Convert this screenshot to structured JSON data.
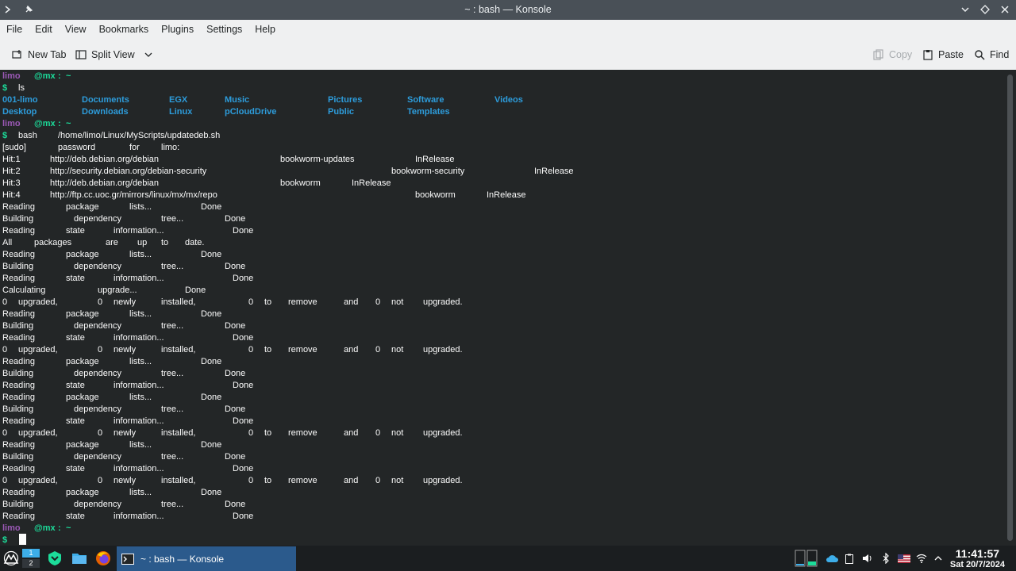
{
  "window": {
    "title": "~ : bash — Konsole"
  },
  "menubar": [
    "File",
    "Edit",
    "View",
    "Bookmarks",
    "Plugins",
    "Settings",
    "Help"
  ],
  "toolbar": {
    "new_tab": "New Tab",
    "split_view": "Split View",
    "copy": "Copy",
    "paste": "Paste",
    "find": "Find"
  },
  "terminal": {
    "prompt_user": "limo",
    "prompt_host": "@mx",
    "prompt_sep": ":",
    "prompt_path": "~",
    "prompt_symbol": "$",
    "cmd1": "ls",
    "ls_row1": [
      "001-limo",
      "Documents",
      "EGX",
      "Music",
      "Pictures",
      "Software",
      "Videos"
    ],
    "ls_row2": [
      "Desktop",
      "Downloads",
      "Linux",
      "pCloudDrive",
      "Public",
      "Templates"
    ],
    "cmd2_a": "bash",
    "cmd2_b": "/home/limo/Linux/MyScripts/updatedeb.sh",
    "sudo_line": [
      "[sudo]",
      "password",
      "for",
      "limo:"
    ],
    "hit1": [
      "Hit:1",
      "http://deb.debian.org/debian",
      "bookworm-updates",
      "InRelease"
    ],
    "hit2": [
      "Hit:2",
      "http://security.debian.org/debian-security",
      "bookworm-security",
      "InRelease"
    ],
    "hit3": [
      "Hit:3",
      "http://deb.debian.org/debian",
      "bookworm",
      "InRelease"
    ],
    "hit4": [
      "Hit:4",
      "http://ftp.cc.uoc.gr/mirrors/linux/mx/mx/repo",
      "bookworm",
      "InRelease"
    ],
    "reading_pkg": [
      "Reading",
      "package",
      "lists...",
      "Done"
    ],
    "building_dep": [
      "Building",
      "dependency",
      "tree...",
      "Done"
    ],
    "reading_state": [
      "Reading",
      "state",
      "information...",
      "Done"
    ],
    "all_uptodate": [
      "All",
      "packages",
      "are",
      "up",
      "to",
      "date."
    ],
    "calculating": [
      "Calculating",
      "upgrade...",
      "Done"
    ],
    "upgraded": [
      "0",
      "upgraded,",
      "0",
      "newly",
      "installed,",
      "0",
      "to",
      "remove",
      "and",
      "0",
      "not",
      "upgraded."
    ]
  },
  "taskbar": {
    "pager": [
      "1",
      "2"
    ],
    "task_label": "~ : bash — Konsole",
    "time": "11:41:57",
    "date": "Sat 20/7/2024"
  },
  "colors": {
    "terminal_bg": "#232627",
    "user": "#9b59b6",
    "host": "#1cdc9a",
    "dir": "#2d9cdb",
    "task_active": "#2b5a8c"
  }
}
